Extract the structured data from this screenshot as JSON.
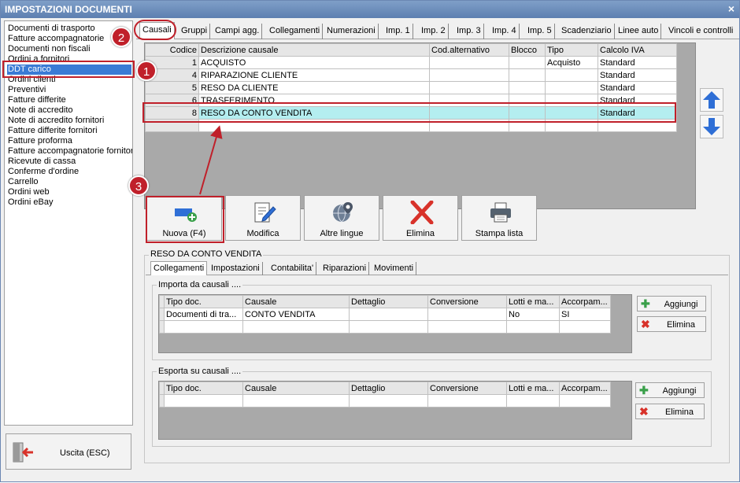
{
  "window": {
    "title": "IMPOSTAZIONI DOCUMENTI",
    "close_glyph": "×"
  },
  "left_list": {
    "items": [
      "Documenti di trasporto",
      "Fatture accompagnatorie",
      "Documenti non fiscali",
      "Ordini a fornitori",
      "DDT carico",
      "Ordini clienti",
      "Preventivi",
      "Fatture differite",
      "Note di accredito",
      "Note di accredito fornitori",
      "Fatture differite fornitori",
      "Fatture proforma",
      "Fatture accompagnatorie fornitori",
      "Ricevute di cassa",
      "Conferme d'ordine",
      "Carrello",
      "Ordini web",
      "Ordini eBay"
    ],
    "selected": "DDT carico"
  },
  "exit_button": {
    "label": "Uscita (ESC)",
    "icon": "exit-door-icon"
  },
  "tabs": [
    "Causali",
    "Gruppi",
    "Campi agg.",
    "Collegamenti",
    "Numerazioni",
    "Imp. 1",
    "Imp. 2",
    "Imp. 3",
    "Imp. 4",
    "Imp. 5",
    "Scadenziario",
    "Linee auto",
    "Vincoli e controlli"
  ],
  "active_tab": "Causali",
  "causali_grid": {
    "columns": [
      "Codice",
      "Descrizione causale",
      "Cod.alternativo",
      "Blocco",
      "Tipo",
      "Calcolo IVA"
    ],
    "rows": [
      {
        "codice": "1",
        "descrizione": "ACQUISTO",
        "cod_alt": "",
        "blocco": "",
        "tipo": "Acquisto",
        "iva": "Standard"
      },
      {
        "codice": "4",
        "descrizione": "RIPARAZIONE CLIENTE",
        "cod_alt": "",
        "blocco": "",
        "tipo": "",
        "iva": "Standard"
      },
      {
        "codice": "5",
        "descrizione": "RESO DA CLIENTE",
        "cod_alt": "",
        "blocco": "",
        "tipo": "",
        "iva": "Standard"
      },
      {
        "codice": "6",
        "descrizione": "TRASFERIMENTO",
        "cod_alt": "",
        "blocco": "",
        "tipo": "",
        "iva": "Standard"
      },
      {
        "codice": "8",
        "descrizione": "RESO DA CONTO VENDITA",
        "cod_alt": "",
        "blocco": "",
        "tipo": "",
        "iva": "Standard"
      }
    ],
    "highlight_color": "#b4eef0"
  },
  "move_buttons": {
    "up_icon": "arrow-up-icon",
    "down_icon": "arrow-down-icon"
  },
  "action_buttons": [
    {
      "label": "Nuova (F4)",
      "icon": "new-record-icon"
    },
    {
      "label": "Modifica",
      "icon": "edit-pencil-icon"
    },
    {
      "label": "Altre lingue",
      "icon": "globe-icon"
    },
    {
      "label": "Elimina",
      "icon": "delete-x-icon"
    },
    {
      "label": "Stampa lista",
      "icon": "printer-icon"
    }
  ],
  "detail": {
    "title": "RESO DA CONTO VENDITA",
    "subtabs": [
      "Collegamenti",
      "Impostazioni",
      "Contabilita'",
      "Riparazioni",
      "Movimenti"
    ],
    "active_subtab": "Collegamenti",
    "importa": {
      "title": "Importa da causali ....",
      "columns": [
        "Tipo doc.",
        "Causale",
        "Dettaglio",
        "Conversione",
        "Lotti e ma...",
        "Accorpam..."
      ],
      "rows": [
        {
          "tipo": "Documenti di tra...",
          "causale": "CONTO VENDITA",
          "dettaglio": "",
          "conversione": "",
          "lotti": "No",
          "accorp": "SI"
        }
      ]
    },
    "esporta": {
      "title": "Esporta su causali ....",
      "columns": [
        "Tipo doc.",
        "Causale",
        "Dettaglio",
        "Conversione",
        "Lotti e ma...",
        "Accorpam..."
      ],
      "rows": []
    },
    "add_label": "Aggiungi",
    "delete_label": "Elimina"
  },
  "annotations": {
    "markers": [
      "1",
      "2",
      "3"
    ],
    "color": "#c0202a"
  }
}
